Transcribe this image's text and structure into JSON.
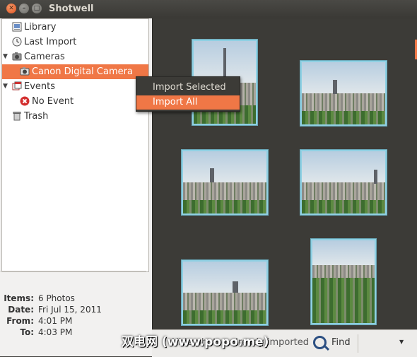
{
  "window": {
    "title": "Shotwell"
  },
  "sidebar": {
    "items": [
      {
        "label": "Library",
        "icon": "library-icon"
      },
      {
        "label": "Last Import",
        "icon": "clock-icon"
      },
      {
        "label": "Cameras",
        "icon": "camera-icon",
        "expanded": true
      },
      {
        "label": "Canon Digital Camera",
        "icon": "camera-icon",
        "selected": true
      },
      {
        "label": "Events",
        "icon": "events-icon",
        "expanded": true
      },
      {
        "label": "No Event",
        "icon": "no-event-icon"
      },
      {
        "label": "Trash",
        "icon": "trash-icon"
      }
    ]
  },
  "info": {
    "items": {
      "label": "Items:",
      "value": "6 Photos"
    },
    "date": {
      "label": "Date:",
      "value": "Fri Jul 15, 2011"
    },
    "from": {
      "label": "From:",
      "value": "4:01 PM"
    },
    "to": {
      "label": "To:",
      "value": "4:03 PM"
    }
  },
  "context_menu": {
    "items": [
      {
        "label": "Import Selected",
        "highlighted": false
      },
      {
        "label": "Import All",
        "highlighted": true
      }
    ]
  },
  "bottombar": {
    "status_text": "Hide photos already imported",
    "find_label": "Find"
  },
  "watermark": "双电网 (www.popo.me)",
  "colors": {
    "accent": "#f07746",
    "thumb_border": "#8fd0e3",
    "background": "#3c3b37"
  }
}
